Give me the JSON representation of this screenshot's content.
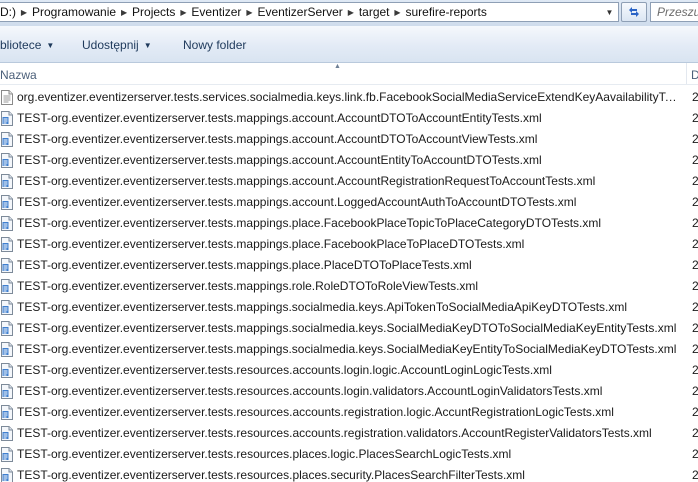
{
  "address": {
    "crumbs": [
      "(D:)",
      "Programowanie",
      "Projects",
      "Eventizer",
      "EventizerServer",
      "target",
      "surefire-reports"
    ]
  },
  "search": {
    "placeholder": "Przeszu"
  },
  "toolbar": {
    "library_label": "blioteсe",
    "share_label": "Udostępnij",
    "new_folder_label": "Nowy folder"
  },
  "columns": {
    "name": "Nazwa",
    "date": "D"
  },
  "files": [
    {
      "name": "org.eventizer.eventizerserver.tests.services.socialmedia.keys.link.fb.FacebookSocialMediaServiceExtendKeyAavailabilityTests....",
      "date": "2",
      "icon": "text-file-icon"
    },
    {
      "name": "TEST-org.eventizer.eventizerserver.tests.mappings.account.AccountDTOToAccountEntityTests.xml",
      "date": "2",
      "icon": "xml-file-icon"
    },
    {
      "name": "TEST-org.eventizer.eventizerserver.tests.mappings.account.AccountDTOToAccountViewTests.xml",
      "date": "2",
      "icon": "xml-file-icon"
    },
    {
      "name": "TEST-org.eventizer.eventizerserver.tests.mappings.account.AccountEntityToAccountDTOTests.xml",
      "date": "2",
      "icon": "xml-file-icon"
    },
    {
      "name": "TEST-org.eventizer.eventizerserver.tests.mappings.account.AccountRegistrationRequestToAccountTests.xml",
      "date": "2",
      "icon": "xml-file-icon"
    },
    {
      "name": "TEST-org.eventizer.eventizerserver.tests.mappings.account.LoggedAccountAuthToAccountDTOTests.xml",
      "date": "2",
      "icon": "xml-file-icon"
    },
    {
      "name": "TEST-org.eventizer.eventizerserver.tests.mappings.place.FacebookPlaceTopicToPlaceCategoryDTOTests.xml",
      "date": "2",
      "icon": "xml-file-icon"
    },
    {
      "name": "TEST-org.eventizer.eventizerserver.tests.mappings.place.FacebookPlaceToPlaceDTOTests.xml",
      "date": "2",
      "icon": "xml-file-icon"
    },
    {
      "name": "TEST-org.eventizer.eventizerserver.tests.mappings.place.PlaceDTOToPlaceTests.xml",
      "date": "2",
      "icon": "xml-file-icon"
    },
    {
      "name": "TEST-org.eventizer.eventizerserver.tests.mappings.role.RoleDTOToRoleViewTests.xml",
      "date": "2",
      "icon": "xml-file-icon"
    },
    {
      "name": "TEST-org.eventizer.eventizerserver.tests.mappings.socialmedia.keys.ApiTokenToSocialMediaApiKeyDTOTests.xml",
      "date": "2",
      "icon": "xml-file-icon"
    },
    {
      "name": "TEST-org.eventizer.eventizerserver.tests.mappings.socialmedia.keys.SocialMediaKeyDTOToSocialMediaKeyEntityTests.xml",
      "date": "2",
      "icon": "xml-file-icon"
    },
    {
      "name": "TEST-org.eventizer.eventizerserver.tests.mappings.socialmedia.keys.SocialMediaKeyEntityToSocialMediaKeyDTOTests.xml",
      "date": "2",
      "icon": "xml-file-icon"
    },
    {
      "name": "TEST-org.eventizer.eventizerserver.tests.resources.accounts.login.logic.AccountLoginLogicTests.xml",
      "date": "2",
      "icon": "xml-file-icon"
    },
    {
      "name": "TEST-org.eventizer.eventizerserver.tests.resources.accounts.login.validators.AccountLoginValidatorsTests.xml",
      "date": "2",
      "icon": "xml-file-icon"
    },
    {
      "name": "TEST-org.eventizer.eventizerserver.tests.resources.accounts.registration.logic.AccuntRegistrationLogicTests.xml",
      "date": "2",
      "icon": "xml-file-icon"
    },
    {
      "name": "TEST-org.eventizer.eventizerserver.tests.resources.accounts.registration.validators.AccountRegisterValidatorsTests.xml",
      "date": "2",
      "icon": "xml-file-icon"
    },
    {
      "name": "TEST-org.eventizer.eventizerserver.tests.resources.places.logic.PlacesSearchLogicTests.xml",
      "date": "2",
      "icon": "xml-file-icon"
    },
    {
      "name": "TEST-org.eventizer.eventizerserver.tests.resources.places.security.PlacesSearchFilterTests.xml",
      "date": "2",
      "icon": "xml-file-icon"
    }
  ],
  "colors": {
    "toolbar_text": "#1e395b",
    "header_text": "#4c607a",
    "address_border": "#8e9fb5"
  }
}
